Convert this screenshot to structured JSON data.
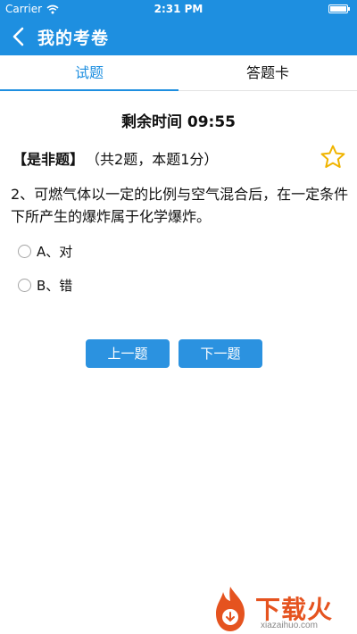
{
  "status_bar": {
    "carrier": "Carrier",
    "time": "2:31 PM"
  },
  "nav": {
    "title": "我的考卷"
  },
  "tabs": [
    {
      "label": "试题",
      "active": true
    },
    {
      "label": "答题卡",
      "active": false
    }
  ],
  "exam": {
    "timer": "剩余时间 09:55",
    "question_type": "【是非题】",
    "question_meta": "（共2题，本题1分）",
    "question_text": "2、可燃气体以一定的比例与空气混合后，在一定条件下所产生的爆炸属于化学爆炸。",
    "options": [
      {
        "label": "A、对"
      },
      {
        "label": "B、错"
      }
    ],
    "prev_label": "上一题",
    "next_label": "下一题"
  },
  "watermark": {
    "brand": "下载火",
    "url": "xiazaihuo.com"
  },
  "colors": {
    "primary": "#1e8fe0",
    "button": "#2b92e0",
    "star": "#f0b400",
    "watermark": "#e5531f"
  }
}
